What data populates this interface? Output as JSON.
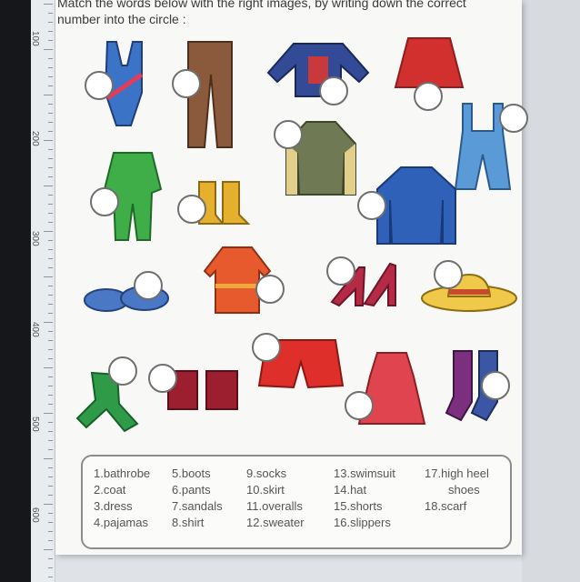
{
  "instruction": {
    "line1": "Match the words below with the right images, by writing down the correct",
    "line2": "number into the circle :"
  },
  "ruler": {
    "labels": [
      "100",
      "200",
      "300",
      "400",
      "500",
      "600"
    ]
  },
  "words": {
    "col1": [
      "1.bathrobe",
      "2.coat",
      "3.dress",
      "4.pajamas"
    ],
    "col2": [
      "5.boots",
      "6.pants",
      "7.sandals",
      "8.shirt"
    ],
    "col3": [
      "9.socks",
      "10.skirt",
      "11.overalls",
      "12.sweater"
    ],
    "col4": [
      "13.swimsuit",
      "14.hat",
      "15.shorts",
      "16.slippers"
    ],
    "col5": [
      "17.high heel",
      "shoes",
      "18.scarf"
    ]
  },
  "colors": {
    "circle_border": "#6f6f6f",
    "page": "#f8f8f6",
    "text": "#555555"
  }
}
